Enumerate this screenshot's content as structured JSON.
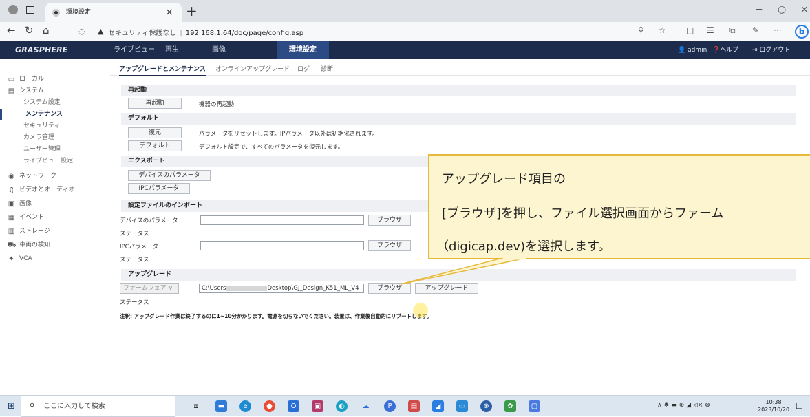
{
  "browser": {
    "tab_title": "環境設定",
    "tab_close": "×",
    "new_tab": "+",
    "security_label": "セキュリティ保護なし",
    "url": "192.168.1.64/doc/page/config.asp",
    "window_controls": [
      "−",
      "○",
      "×"
    ]
  },
  "app": {
    "logo": "GRASPHERE",
    "nav": [
      "ライブビュー",
      "再生",
      "画像",
      "環境設定"
    ],
    "active_nav": "環境設定",
    "user": "admin",
    "help": "ヘルプ",
    "logout": "ログアウト"
  },
  "sidebar": {
    "items": [
      {
        "label": "ローカル",
        "icon": "monitor-icon"
      },
      {
        "label": "システム",
        "icon": "system-icon"
      },
      {
        "label": "システム設定",
        "sub": true
      },
      {
        "label": "メンテナンス",
        "sub": true,
        "active": true
      },
      {
        "label": "セキュリティ",
        "sub": true
      },
      {
        "label": "カメラ管理",
        "sub": true
      },
      {
        "label": "ユーザー管理",
        "sub": true
      },
      {
        "label": "ライブビュー設定",
        "sub": true
      },
      {
        "label": "ネットワーク",
        "icon": "network-icon"
      },
      {
        "label": "ビデオとオーディオ",
        "icon": "video-audio-icon"
      },
      {
        "label": "画像",
        "icon": "image-icon"
      },
      {
        "label": "イベント",
        "icon": "event-icon"
      },
      {
        "label": "ストレージ",
        "icon": "storage-icon"
      },
      {
        "label": "車両の検知",
        "icon": "vehicle-icon"
      },
      {
        "label": "VCA",
        "icon": "vca-icon"
      }
    ]
  },
  "subtabs": [
    "アップグレードとメンテナンス",
    "オンラインアップグレード",
    "ログ",
    "診断"
  ],
  "sections": {
    "reboot": {
      "title": "再起動",
      "button": "再起動",
      "desc": "機器の再起動"
    },
    "default": {
      "title": "デフォルト",
      "restore_button": "復元",
      "restore_desc": "パラメータをリセットします。IPパラメータ以外は初期化されます。",
      "default_button": "デフォルト",
      "default_desc": "デフォルト設定で、すべてのパラメータを復元します。"
    },
    "export": {
      "title": "エクスポート",
      "device_params_button": "デバイスのパラメータ",
      "ipc_params_button": "IPCパラメータ"
    },
    "import": {
      "title": "設定ファイルのインポート",
      "device_params_label": "デバイスのパラメータ",
      "status_label": "ステータス",
      "ipc_params_label": "IPCパラメータ",
      "status_label_2": "ステータス",
      "browse_button": "ブラウザ",
      "browse_button_2": "ブラウザ",
      "device_value": "",
      "ipc_value": ""
    },
    "upgrade": {
      "title": "アップグレード",
      "type_select": "ファームウェア",
      "path_prefix": "C:\\Users",
      "path_suffix": "Desktop\\GJ_Design_K51_ML_V4",
      "browse_button": "ブラウザ",
      "upgrade_button": "アップグレード",
      "status_label": "ステータス"
    },
    "note": "注釈: アップグレード作業は終了するのに1~10分かかります。電源を切らないでください。装置は、作業後自動的にリブートします。"
  },
  "callout": {
    "line1": "アップグレード項目の",
    "line2": "[ブラウザ]を押し、ファイル選択画面からファーム",
    "line3": "（digicap.dev)を選択します。"
  },
  "taskbar": {
    "search_placeholder": "ここに入力して検索",
    "time": "10:38",
    "date": "2023/10/20"
  },
  "colors": {
    "app_nav_bg": "#1d2c4c",
    "active_nav_bg": "#2c4a84",
    "callout_bg": "#fdf5cf",
    "callout_border": "#e6b93a"
  }
}
